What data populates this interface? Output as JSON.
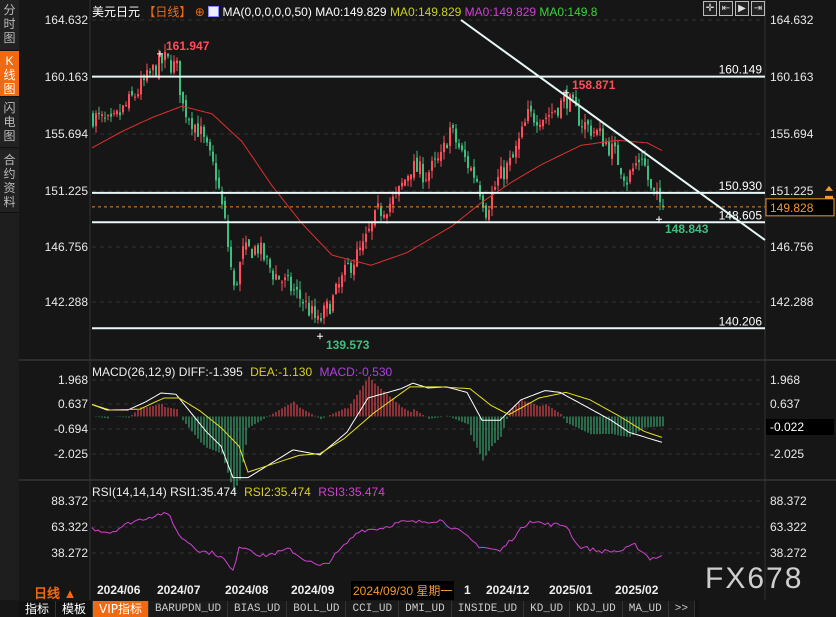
{
  "sidebar": {
    "items": [
      {
        "label": "分时图",
        "active": false
      },
      {
        "label": "K线图",
        "active": true
      },
      {
        "label": "闪电图",
        "active": false
      },
      {
        "label": "合约资料",
        "active": false
      }
    ]
  },
  "header": {
    "symbol": "美元日元",
    "period": "【日线】",
    "ma_params": "MA(0,0,0,0,0,50)",
    "ma0_a": "MA0:149.829",
    "ma0_b": "MA0:149.829",
    "ma0_c": "MA0:149.829",
    "ma0_d": "MA0:149.8",
    "toolbar_icons": [
      "crosshair-icon",
      "zoom-range-icon",
      "play-range-icon",
      "scroll-end-icon"
    ]
  },
  "price_axis": {
    "labels": [
      "164.632",
      "160.163",
      "155.694",
      "151.225",
      "146.756",
      "142.288"
    ],
    "current": "149.828"
  },
  "levels": [
    {
      "value": 160.149,
      "label": "160.149"
    },
    {
      "value": 150.93,
      "label": "150.930"
    },
    {
      "value": 148.605,
      "label": "148.605"
    },
    {
      "value": 140.206,
      "label": "140.206"
    }
  ],
  "markers": {
    "high1": "161.947",
    "high2": "158.871",
    "low1": "139.573",
    "low2": "148.843"
  },
  "macd": {
    "title": "MACD(26,12,9)",
    "diff": "DIFF:-1.395",
    "dea": "DEA:-1.130",
    "macd": "MACD:-0.530",
    "axis": [
      "1.968",
      "0.637",
      "-0.694",
      "-2.025"
    ],
    "current": "-0.022"
  },
  "rsi": {
    "title": "RSI(14,14,14)",
    "rsi1": "RSI1:35.474",
    "rsi2": "RSI2:35.474",
    "rsi3": "RSI3:35.474",
    "axis": [
      "88.372",
      "63.322",
      "38.272"
    ]
  },
  "time_axis": {
    "period": "日线",
    "labels": [
      "2024/06",
      "2024/07",
      "2024/08",
      "2024/09",
      "1",
      "2024/12",
      "2025/01",
      "2025/02"
    ],
    "cursor_date": "2024/09/30 星期一"
  },
  "watermark": "FX678",
  "tabs": [
    "指标",
    "模板",
    "VIP指标",
    "BARUPDN_UD",
    "BIAS_UD",
    "BOLL_UD",
    "CCI_UD",
    "DMI_UD",
    "INSIDE_UD",
    "KD_UD",
    "KDJ_UD",
    "MA_UD",
    ">>"
  ],
  "colors": {
    "up": "#ff4d5a",
    "down": "#3fbf7f",
    "ma50": "#e03030",
    "diff": "#ffffff",
    "dea": "#e8e020",
    "rsi": "#d040d0",
    "accent": "#f26a10"
  },
  "chart_data": {
    "type": "candlestick",
    "price_range": [
      139.0,
      164.632
    ],
    "close_path": [
      [
        0,
        157.0
      ],
      [
        6,
        156.3
      ],
      [
        13,
        158.4
      ],
      [
        20,
        160.6
      ],
      [
        24,
        161.5
      ],
      [
        28,
        160.8
      ],
      [
        30,
        157.8
      ],
      [
        36,
        155.6
      ],
      [
        41,
        152.4
      ],
      [
        44,
        148.5
      ],
      [
        47,
        143.2
      ],
      [
        50,
        146.2
      ],
      [
        55,
        146.6
      ],
      [
        60,
        144.6
      ],
      [
        66,
        143.4
      ],
      [
        70,
        142.4
      ],
      [
        75,
        140.6
      ],
      [
        80,
        142.5
      ],
      [
        85,
        145.0
      ],
      [
        90,
        146.6
      ],
      [
        95,
        149.4
      ],
      [
        101,
        150.5
      ],
      [
        106,
        153.0
      ],
      [
        111,
        152.4
      ],
      [
        116,
        153.6
      ],
      [
        119,
        156.0
      ],
      [
        123,
        154.0
      ],
      [
        128,
        152.0
      ],
      [
        131,
        149.6
      ],
      [
        135,
        152.0
      ],
      [
        140,
        153.6
      ],
      [
        145,
        157.0
      ],
      [
        151,
        157.0
      ],
      [
        158,
        158.4
      ],
      [
        163,
        156.5
      ],
      [
        169,
        155.5
      ],
      [
        174,
        154.0
      ],
      [
        178,
        152.0
      ],
      [
        183,
        154.0
      ],
      [
        186,
        151.0
      ],
      [
        190,
        149.83
      ]
    ],
    "ma50_path": [
      [
        0,
        154.5
      ],
      [
        10,
        155.8
      ],
      [
        20,
        156.9
      ],
      [
        30,
        157.8
      ],
      [
        40,
        157.2
      ],
      [
        50,
        155.0
      ],
      [
        60,
        151.5
      ],
      [
        70,
        148.5
      ],
      [
        80,
        146.0
      ],
      [
        93,
        145.2
      ],
      [
        105,
        146.2
      ],
      [
        120,
        148.3
      ],
      [
        130,
        150.2
      ],
      [
        140,
        151.8
      ],
      [
        150,
        153.2
      ],
      [
        163,
        154.7
      ],
      [
        175,
        155.1
      ],
      [
        185,
        154.9
      ],
      [
        190,
        154.3
      ]
    ],
    "diff_path": [
      [
        0,
        0.65
      ],
      [
        5,
        0.35
      ],
      [
        12,
        0.35
      ],
      [
        18,
        0.8
      ],
      [
        23,
        1.27
      ],
      [
        28,
        1.2
      ],
      [
        33,
        0.2
      ],
      [
        38,
        -0.8
      ],
      [
        43,
        -1.6
      ],
      [
        47,
        -3.3
      ],
      [
        52,
        -3.3
      ],
      [
        57,
        -2.8
      ],
      [
        67,
        -1.8
      ],
      [
        76,
        -2.07
      ],
      [
        85,
        -0.84
      ],
      [
        92,
        1.0
      ],
      [
        103,
        1.5
      ],
      [
        107,
        1.8
      ],
      [
        112,
        1.54
      ],
      [
        118,
        1.6
      ],
      [
        125,
        1.3
      ],
      [
        130,
        -0.2
      ],
      [
        136,
        -0.2
      ],
      [
        143,
        0.9
      ],
      [
        151,
        1.4
      ],
      [
        156,
        1.3
      ],
      [
        164,
        0.6
      ],
      [
        173,
        -0.2
      ],
      [
        179,
        -0.85
      ],
      [
        190,
        -1.395
      ]
    ],
    "dea_path": [
      [
        0,
        0.65
      ],
      [
        6,
        0.35
      ],
      [
        16,
        0.4
      ],
      [
        24,
        1.0
      ],
      [
        29,
        1.0
      ],
      [
        36,
        0.3
      ],
      [
        43,
        -0.6
      ],
      [
        49,
        -1.6
      ],
      [
        52,
        -3.0
      ],
      [
        69,
        -2.1
      ],
      [
        76,
        -2.0
      ],
      [
        84,
        -1.2
      ],
      [
        94,
        0.2
      ],
      [
        106,
        1.6
      ],
      [
        116,
        1.6
      ],
      [
        126,
        1.5
      ],
      [
        133,
        0.6
      ],
      [
        139,
        0.1
      ],
      [
        149,
        1.0
      ],
      [
        158,
        1.3
      ],
      [
        166,
        0.9
      ],
      [
        176,
        0.0
      ],
      [
        184,
        -0.8
      ],
      [
        190,
        -1.13
      ]
    ],
    "macd_range": [
      -3.6,
      2.2
    ],
    "rsi_path": [
      [
        0,
        62
      ],
      [
        6,
        58
      ],
      [
        13,
        68
      ],
      [
        19,
        73
      ],
      [
        23,
        76
      ],
      [
        26,
        74
      ],
      [
        29,
        55
      ],
      [
        33,
        47
      ],
      [
        36,
        40
      ],
      [
        41,
        38
      ],
      [
        44,
        32
      ],
      [
        47,
        20
      ],
      [
        49,
        45
      ],
      [
        53,
        42
      ],
      [
        56,
        35
      ],
      [
        61,
        38
      ],
      [
        66,
        42
      ],
      [
        69,
        35
      ],
      [
        76,
        25
      ],
      [
        79,
        30
      ],
      [
        84,
        45
      ],
      [
        89,
        60
      ],
      [
        96,
        62
      ],
      [
        103,
        68
      ],
      [
        108,
        68
      ],
      [
        116,
        70
      ],
      [
        123,
        58
      ],
      [
        129,
        45
      ],
      [
        136,
        40
      ],
      [
        141,
        55
      ],
      [
        146,
        70
      ],
      [
        151,
        66
      ],
      [
        158,
        65
      ],
      [
        162,
        45
      ],
      [
        169,
        40
      ],
      [
        176,
        40
      ],
      [
        181,
        46
      ],
      [
        186,
        33
      ],
      [
        190,
        35.474
      ]
    ],
    "trendline": {
      "from": [
        123,
        164.632
      ],
      "to": [
        224,
        147.2
      ]
    }
  }
}
